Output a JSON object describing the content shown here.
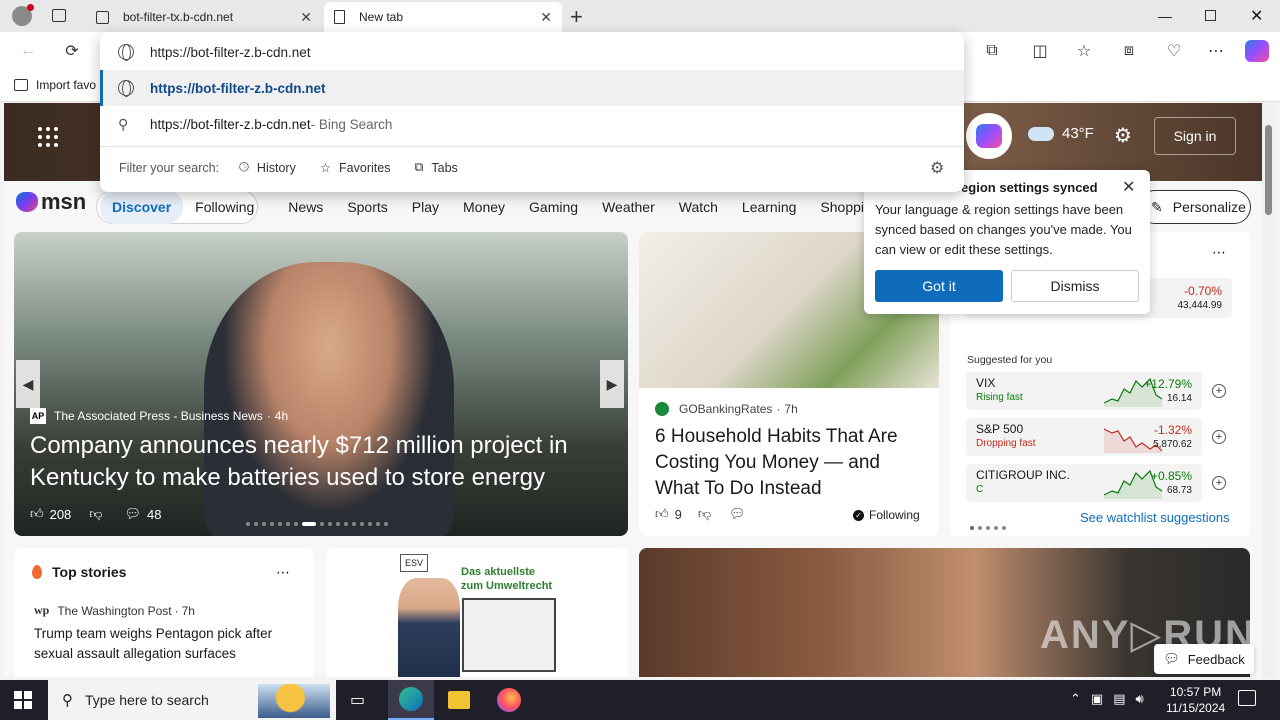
{
  "tabs": [
    {
      "title": "bot-filter-tx.b-cdn.net"
    },
    {
      "title": "New tab"
    }
  ],
  "address": {
    "value": "https://bot-filter-z.b-cdn.net"
  },
  "favorites": {
    "import_label": "Import favo"
  },
  "omnibox": {
    "suggestion_url": "https://bot-filter-z.b-cdn.net",
    "search_text": "https://bot-filter-z.b-cdn.net",
    "search_suffix": " - Bing Search",
    "filter_label": "Filter your search:",
    "filters": [
      "History",
      "Favorites",
      "Tabs"
    ]
  },
  "header": {
    "temp": "43°F",
    "signin": "Sign in"
  },
  "nav": {
    "logo": "msn",
    "items": [
      "Discover",
      "Following",
      "News",
      "Sports",
      "Play",
      "Money",
      "Gaming",
      "Weather",
      "Watch",
      "Learning",
      "Shopping"
    ],
    "personalize": "Personalize"
  },
  "popup": {
    "title": "region settings synced",
    "body": "Your language & region settings have been synced based on changes you've made. You can view or edit these settings.",
    "got_it": "Got it",
    "dismiss": "Dismiss"
  },
  "hero": {
    "source": "The Associated Press - Business News",
    "time": "4h",
    "headline": "Company announces nearly $712 million project in Kentucky to make batteries used to store energy",
    "likes": "208",
    "comments": "48"
  },
  "article2": {
    "source": "GOBankingRates",
    "time": "7h",
    "headline": "6 Household Habits That Are Costing You Money — and What To Do Instead",
    "likes": "9",
    "following": "Following"
  },
  "watchlist": {
    "top_change": "-0.70%",
    "top_value": "43,444.99",
    "suggested_label": "Suggested for you",
    "stocks": [
      {
        "name": "VIX",
        "status": "Rising fast",
        "change": "+12.79%",
        "value": "16.14",
        "color": "#0a7a0a"
      },
      {
        "name": "S&P 500",
        "status": "Dropping fast",
        "change": "-1.32%",
        "value": "5,870.62",
        "color": "#c42b1c"
      },
      {
        "name": "CITIGROUP INC.",
        "status": "C",
        "change": "+0.85%",
        "value": "68.73",
        "color": "#0a7a0a"
      }
    ],
    "see_more": "See watchlist suggestions"
  },
  "top_stories": {
    "title": "Top stories",
    "source": "The Washington Post",
    "time": "7h",
    "headline": "Trump team weighs Pentagon pick after sexual assault allegation surfaces"
  },
  "ad": {
    "line1": "Das aktuellste",
    "line2": "zum Umweltrecht"
  },
  "feedback": "Feedback",
  "taskbar": {
    "search_placeholder": "Type here to search",
    "time": "10:57 PM",
    "date": "11/15/2024"
  }
}
